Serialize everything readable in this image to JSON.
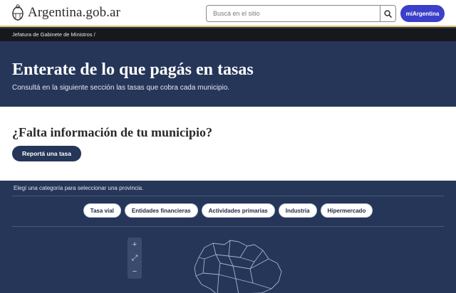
{
  "header": {
    "site_name": "Argentina.gob.ar",
    "search_placeholder": "Buscá en el sitio",
    "mi_argentina_label": "miArgentina"
  },
  "breadcrumb": {
    "text": "Jefatura de Gabinete de Ministros /"
  },
  "hero": {
    "title": "Enterate de lo que pagás en tasas",
    "subtitle": "Consultá en la siguiente sección las tasas que cobra cada municipio."
  },
  "report": {
    "title": "¿Falta información de tu municipio?",
    "button_label": "Reportá una tasa"
  },
  "categories": {
    "hint": "Elegí una categoría para seleccionar una provincia.",
    "items": [
      {
        "label": "Tasa vial"
      },
      {
        "label": "Entidades financieras"
      },
      {
        "label": "Actividades primarias"
      },
      {
        "label": "Industria"
      },
      {
        "label": "Hipermercado"
      }
    ]
  },
  "map_controls": {
    "zoom_in": "+",
    "fullscreen": "⤢",
    "zoom_out": "−"
  },
  "colors": {
    "navy": "#253659",
    "accent_blue": "#3b3fc9",
    "gold_rule": "#e8c15a"
  }
}
